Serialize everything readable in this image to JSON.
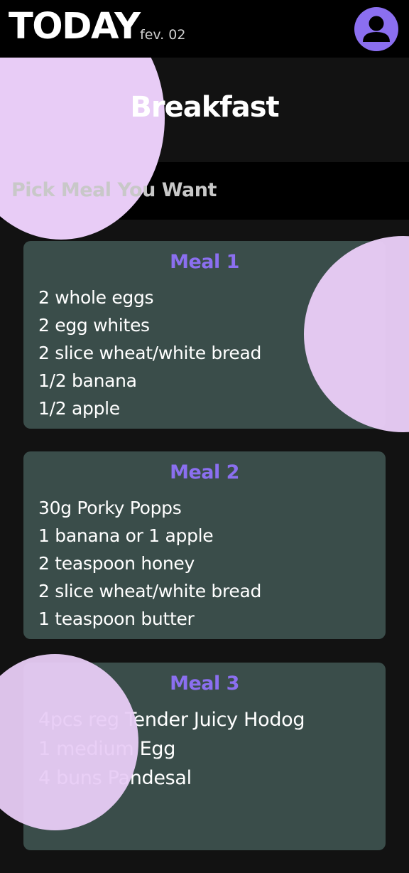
{
  "header": {
    "title": "TODAY",
    "date": "fev. 02",
    "avatar_icon": "user-avatar-icon",
    "accent_color": "#8b6ff0"
  },
  "hero": {
    "title": "Breakfast"
  },
  "subheader": {
    "text": "Pick Meal You Want"
  },
  "meals": [
    {
      "title": "Meal 1",
      "items": [
        "2 whole eggs",
        "2 egg whites",
        "2 slice wheat/white bread",
        "1/2 banana",
        "1/2 apple"
      ]
    },
    {
      "title": "Meal 2",
      "items": [
        "30g Porky Popps",
        "1 banana or 1 apple",
        "2 teaspoon honey",
        "2 slice wheat/white bread",
        "1 teaspoon butter"
      ]
    },
    {
      "title": "Meal 3",
      "items": [
        "4pcs reg Tender Juicy Hodog",
        "1 medium Egg",
        "4 buns Pandesal"
      ]
    }
  ],
  "colors": {
    "background": "#121212",
    "bar": "#000000",
    "card": "#3a4d4a",
    "blob": "#e8ccf6",
    "meal_title": "#8b6ff0"
  }
}
